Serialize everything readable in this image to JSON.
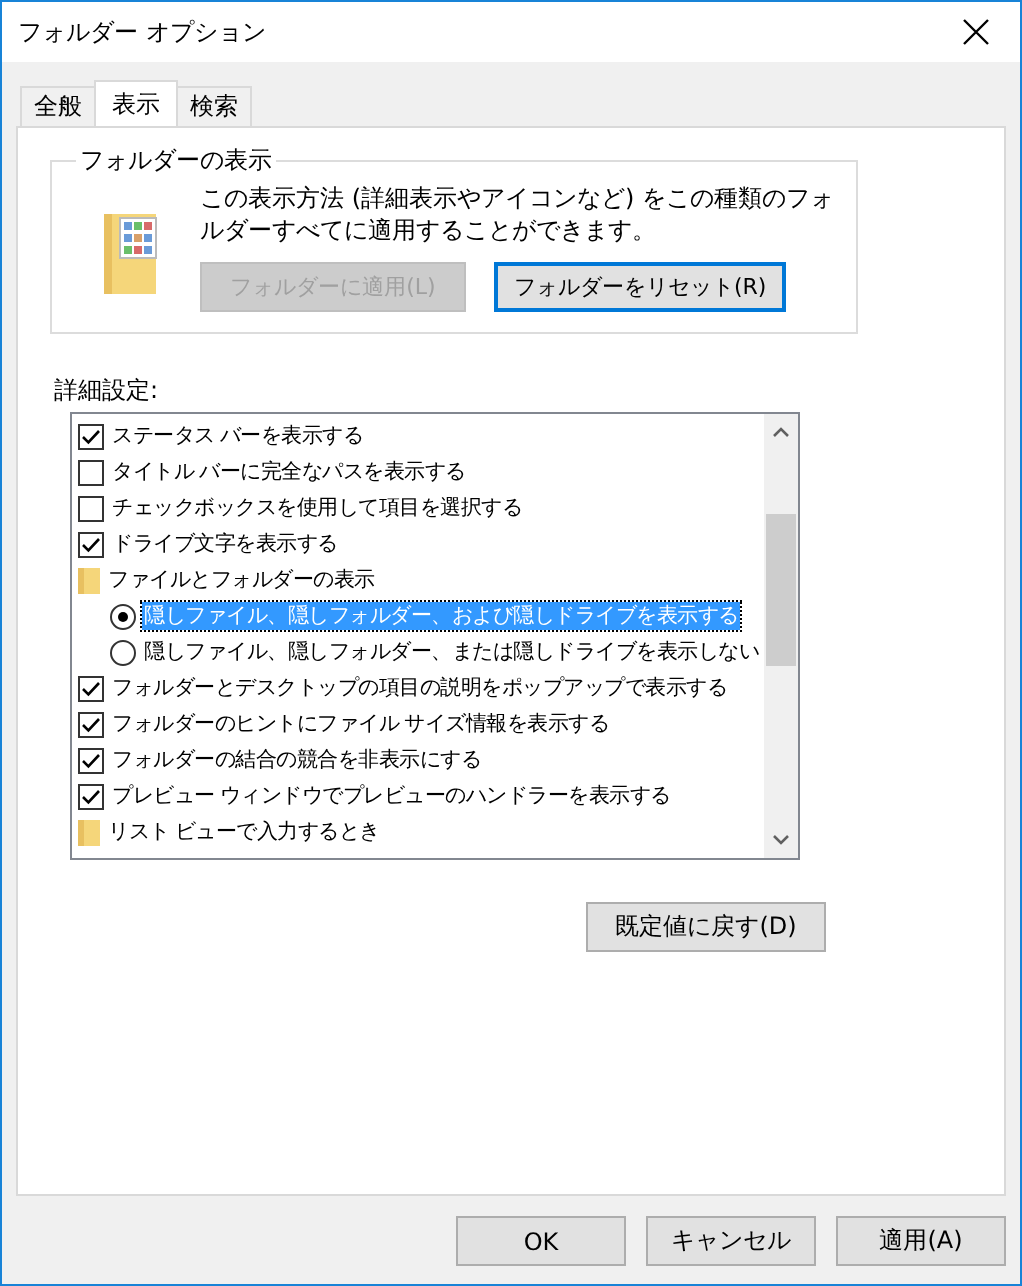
{
  "window": {
    "title": "フォルダー オプション"
  },
  "tabs": [
    {
      "label": "全般",
      "selected": false
    },
    {
      "label": "表示",
      "selected": true
    },
    {
      "label": "検索",
      "selected": false
    }
  ],
  "folder_views": {
    "title": "フォルダーの表示",
    "description": "この表示方法 (詳細表示やアイコンなど) をこの種類のフォルダーすべてに適用することができます。",
    "buttons": [
      {
        "label": "フォルダーに適用(L)",
        "disabled": true,
        "focused": false
      },
      {
        "label": "フォルダーをリセット(R)",
        "disabled": false,
        "focused": true
      }
    ]
  },
  "advanced": {
    "label": "詳細設定:",
    "items": [
      {
        "kind": "checkbox",
        "label": "ステータス バーを表示する",
        "checked": true
      },
      {
        "kind": "checkbox",
        "label": "タイトル バーに完全なパスを表示する",
        "checked": false
      },
      {
        "kind": "checkbox",
        "label": "チェックボックスを使用して項目を選択する",
        "checked": false
      },
      {
        "kind": "checkbox",
        "label": "ドライブ文字を表示する",
        "checked": true
      },
      {
        "kind": "folder",
        "label": "ファイルとフォルダーの表示",
        "children": [
          {
            "kind": "radio",
            "label": "隠しファイル、隠しフォルダー、および隠しドライブを表示する",
            "selected": true
          },
          {
            "kind": "radio",
            "label": "隠しファイル、隠しフォルダー、または隠しドライブを表示しない",
            "selected": false
          }
        ]
      },
      {
        "kind": "checkbox",
        "label": "フォルダーとデスクトップの項目の説明をポップアップで表示する",
        "checked": true
      },
      {
        "kind": "checkbox",
        "label": "フォルダーのヒントにファイル サイズ情報を表示する",
        "checked": true
      },
      {
        "kind": "checkbox",
        "label": "フォルダーの結合の競合を非表示にする",
        "checked": true
      },
      {
        "kind": "checkbox",
        "label": "プレビュー ウィンドウでプレビューのハンドラーを表示する",
        "checked": true
      },
      {
        "kind": "folder",
        "label": "リスト ビューで入力するとき"
      }
    ],
    "restore_button": "既定値に戻す(D)"
  },
  "buttons": [
    "OK",
    "キャンセル",
    "適用(A)"
  ]
}
